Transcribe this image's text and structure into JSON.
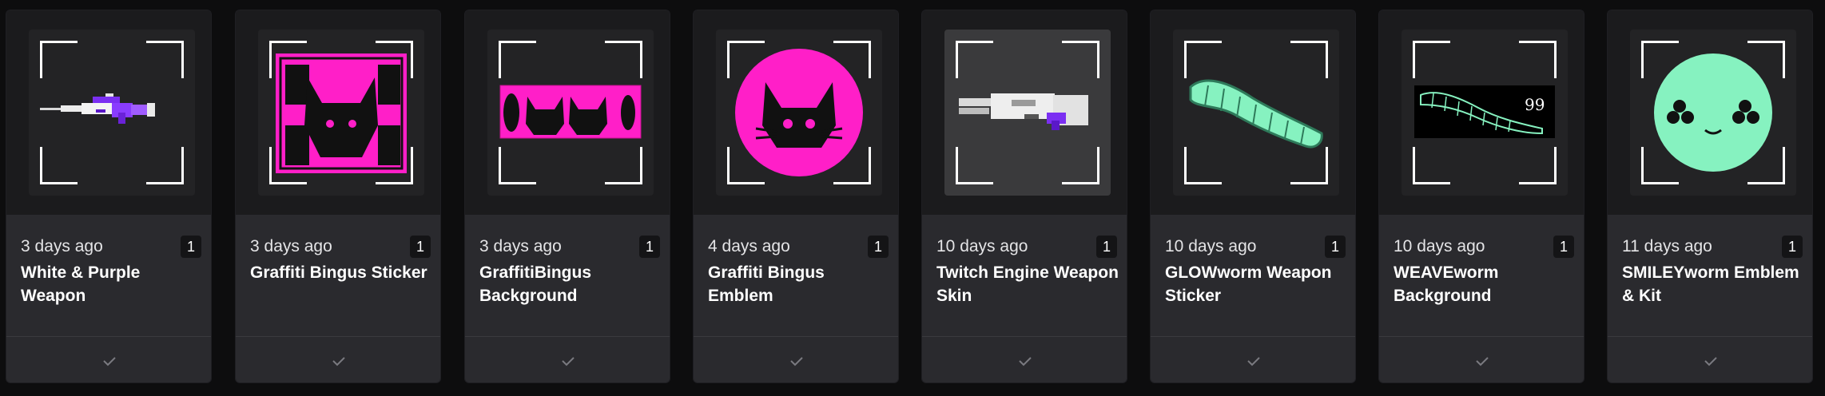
{
  "colors": {
    "card_bg": "#2a2a2e",
    "magenta": "#ff1fc8",
    "mint": "#86f2c0",
    "purple": "#8a3cff"
  },
  "cards": [
    {
      "date": "3 days ago",
      "qty": "1",
      "title": "White & Purple Weapon",
      "image": "white-purple-rifle"
    },
    {
      "date": "3 days ago",
      "qty": "1",
      "title": "Graffiti Bingus Sticker",
      "image": "pink-graffiti-cat-sticker"
    },
    {
      "date": "3 days ago",
      "qty": "1",
      "title": "GraffitiBingus Background",
      "image": "pink-graffiti-background"
    },
    {
      "date": "4 days ago",
      "qty": "1",
      "title": "Graffiti Bingus Emblem",
      "image": "pink-cat-emblem"
    },
    {
      "date": "10 days ago",
      "qty": "1",
      "title": "Twitch Engine Weapon Skin",
      "image": "white-engine-gun"
    },
    {
      "date": "10 days ago",
      "qty": "1",
      "title": "GLOWworm Weapon Sticker",
      "image": "mint-caterpillar"
    },
    {
      "date": "10 days ago",
      "qty": "1",
      "title": "WEAVEworm Background",
      "image": "caterpillar-background"
    },
    {
      "date": "11 days ago",
      "qty": "1",
      "title": "SMILEYworm Emblem & Kit",
      "image": "mint-smiley-face"
    }
  ],
  "art_text": {
    "weave_number": "99"
  },
  "icons": {
    "check": "check-icon"
  }
}
